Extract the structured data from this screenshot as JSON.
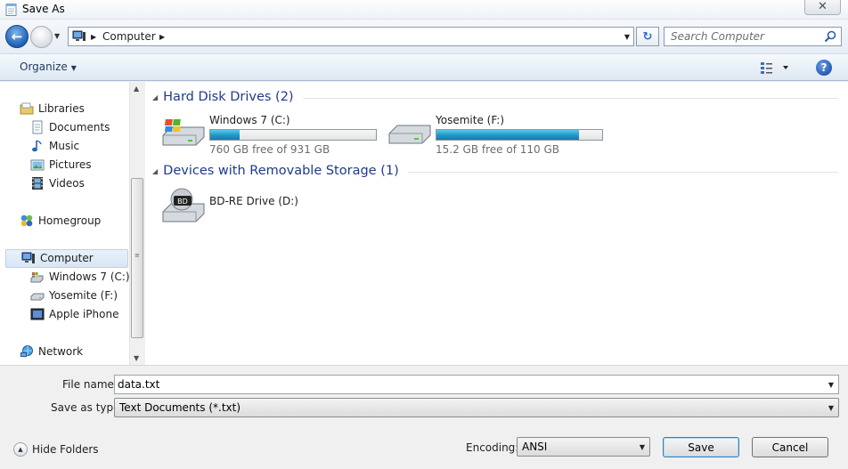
{
  "window": {
    "title": "Save As",
    "close_label": "✕"
  },
  "navbar": {
    "address_path": "Computer",
    "search_placeholder": "Search Computer"
  },
  "toolbar": {
    "organize_label": "Organize"
  },
  "nav_pane": {
    "libraries": "Libraries",
    "documents": "Documents",
    "music": "Music",
    "pictures": "Pictures",
    "videos": "Videos",
    "homegroup": "Homegroup",
    "computer": "Computer",
    "windows7": "Windows 7 (C:)",
    "yosemite": "Yosemite (F:)",
    "iphone": "Apple iPhone",
    "network": "Network"
  },
  "content": {
    "hdd_group": "Hard Disk Drives (2)",
    "removable_group": "Devices with Removable Storage (1)",
    "drives": [
      {
        "name": "Windows 7 (C:)",
        "free_text": "760 GB free of 931 GB",
        "used_fraction": 0.18
      },
      {
        "name": "Yosemite (F:)",
        "free_text": "15.2 GB free of 110 GB",
        "used_fraction": 0.86
      }
    ],
    "removable": [
      {
        "name": "BD-RE Drive (D:)",
        "badge": "BD"
      }
    ]
  },
  "bottom": {
    "filename_label": "File name:",
    "filename_value": "data.txt",
    "savetype_label": "Save as type:",
    "savetype_value": "Text Documents (*.txt)",
    "hide_folders_label": "Hide Folders",
    "encoding_label": "Encoding:",
    "encoding_value": "ANSI",
    "save_label": "Save",
    "cancel_label": "Cancel"
  }
}
